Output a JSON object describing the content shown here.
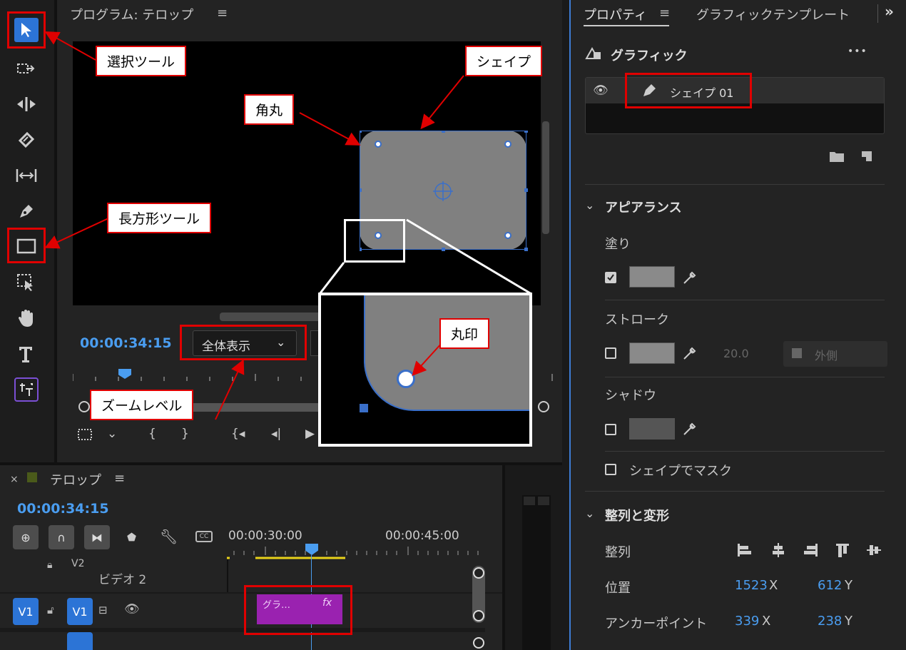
{
  "program": {
    "title": "プログラム: テロップ",
    "menu_icon": "hamburger-icon",
    "timecode": "00:00:34:15",
    "zoom_value": "全体表示"
  },
  "timeline": {
    "close": "×",
    "title": "テロップ",
    "timecode": "00:00:34:15",
    "ruler_left": "00:00:30:00",
    "ruler_right": "00:00:45:00",
    "track_v2_id": "V2",
    "track_v2_name": "ビデオ 2",
    "track_v1_src": "V1",
    "track_v1_tgt": "V1",
    "clip_label": "グラ…",
    "clip_fx": "fx"
  },
  "properties": {
    "tab_properties": "プロパティ",
    "tab_graphic_templates": "グラフィックテンプレート",
    "more": "»",
    "graphic_label": "グラフィック",
    "dots": "•••",
    "layer_name": "シェイプ 01",
    "appearance": "アピアランス",
    "fill": "塗り",
    "stroke": "ストローク",
    "stroke_width": "20.0",
    "stroke_side": "外側",
    "shadow": "シャドウ",
    "mask_with_shape": "シェイプでマスク",
    "align_transform": "整列と変形",
    "align": "整列",
    "position": "位置",
    "position_x": "1523",
    "position_y": "612",
    "anchor": "アンカーポイント",
    "anchor_x": "339",
    "anchor_y": "238",
    "x_unit": "X",
    "y_unit": "Y"
  },
  "callouts": {
    "selection_tool": "選択ツール",
    "shape": "シェイプ",
    "corner_radius": "角丸",
    "rectangle_tool": "長方形ツール",
    "zoom_level": "ズームレベル",
    "round_mark": "丸印"
  },
  "colors": {
    "accent_blue": "#4a9df0",
    "annotation_red": "#e00000",
    "clip_purple": "#9a22b0",
    "shape_gray": "#808080"
  }
}
